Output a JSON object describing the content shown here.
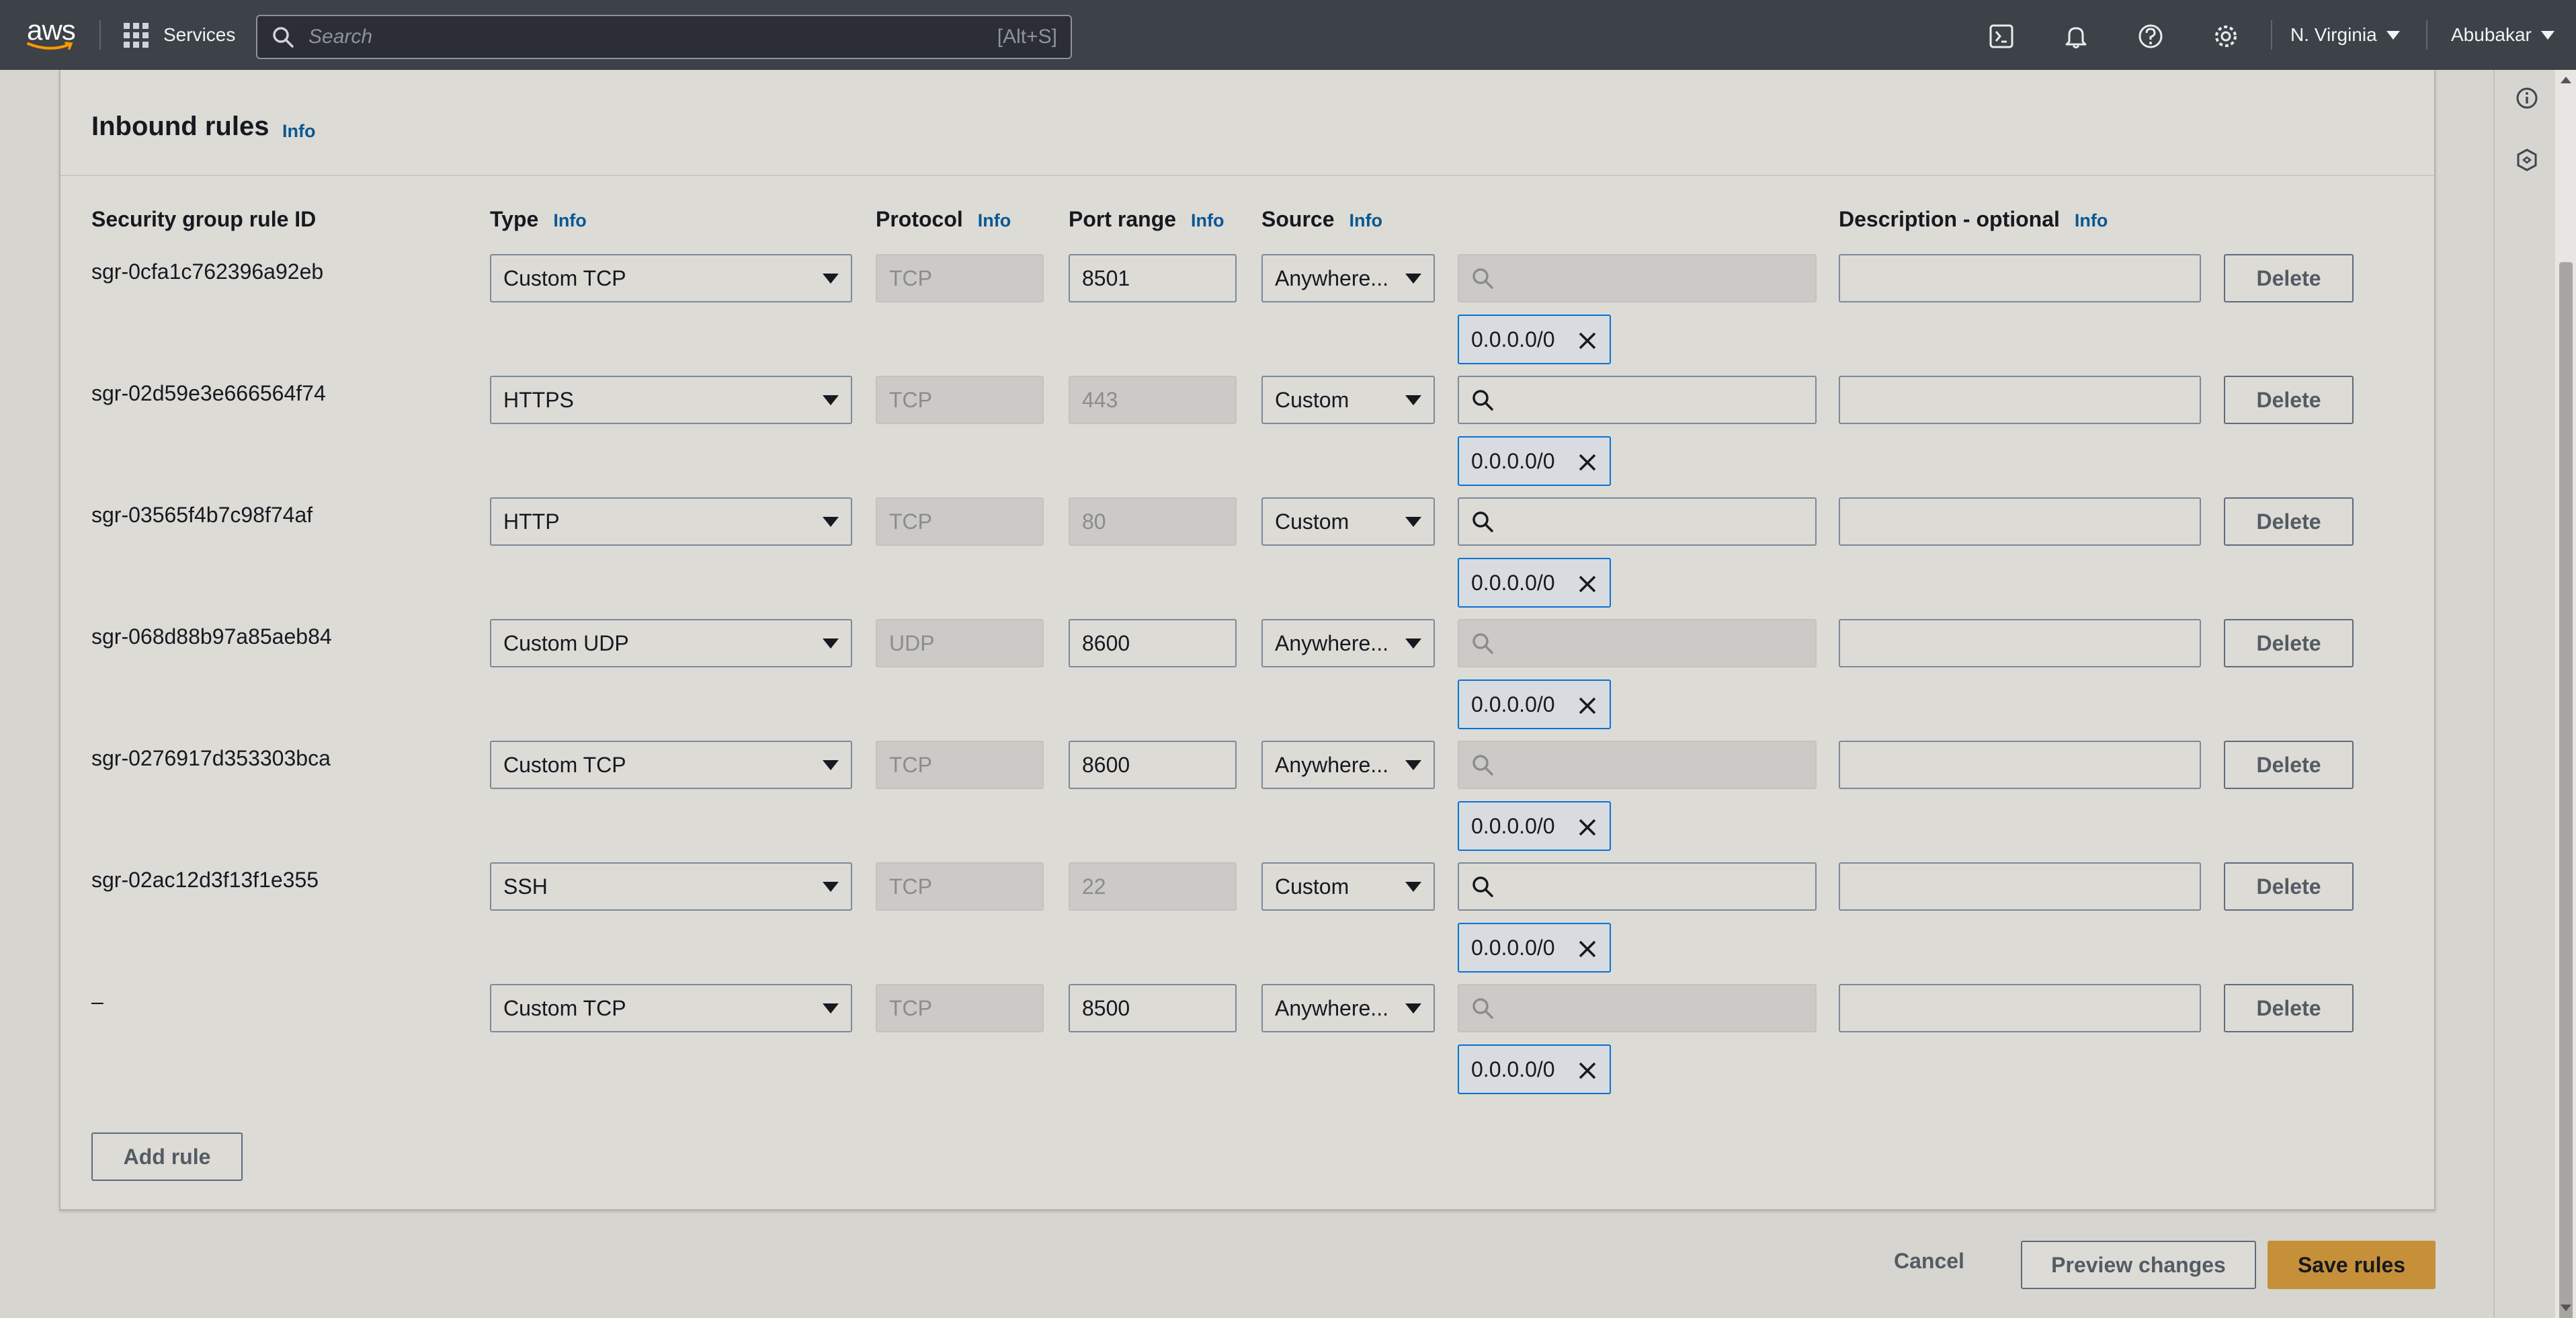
{
  "nav": {
    "logo_text": "aws",
    "services_label": "Services",
    "search_placeholder": "Search",
    "search_shortcut": "[Alt+S]",
    "region": "N. Virginia",
    "account": "Abubakar"
  },
  "panel": {
    "title": "Inbound rules",
    "info": "Info"
  },
  "columns": {
    "rule_id": "Security group rule ID",
    "type": "Type",
    "protocol": "Protocol",
    "port_range": "Port range",
    "source": "Source",
    "description": "Description - optional",
    "info": "Info"
  },
  "rules": [
    {
      "id": "sgr-0cfa1c762396a92eb",
      "type": "Custom TCP",
      "protocol": "TCP",
      "port": "8501",
      "port_editable": true,
      "source": "Anywhere...",
      "search_enabled": false,
      "cidr": "0.0.0.0/0",
      "delete": "Delete"
    },
    {
      "id": "sgr-02d59e3e666564f74",
      "type": "HTTPS",
      "protocol": "TCP",
      "port": "443",
      "port_editable": false,
      "source": "Custom",
      "search_enabled": true,
      "cidr": "0.0.0.0/0",
      "delete": "Delete"
    },
    {
      "id": "sgr-03565f4b7c98f74af",
      "type": "HTTP",
      "protocol": "TCP",
      "port": "80",
      "port_editable": false,
      "source": "Custom",
      "search_enabled": true,
      "cidr": "0.0.0.0/0",
      "delete": "Delete"
    },
    {
      "id": "sgr-068d88b97a85aeb84",
      "type": "Custom UDP",
      "protocol": "UDP",
      "port": "8600",
      "port_editable": true,
      "source": "Anywhere...",
      "search_enabled": false,
      "cidr": "0.0.0.0/0",
      "delete": "Delete"
    },
    {
      "id": "sgr-0276917d353303bca",
      "type": "Custom TCP",
      "protocol": "TCP",
      "port": "8600",
      "port_editable": true,
      "source": "Anywhere...",
      "search_enabled": false,
      "cidr": "0.0.0.0/0",
      "delete": "Delete"
    },
    {
      "id": "sgr-02ac12d3f13f1e355",
      "type": "SSH",
      "protocol": "TCP",
      "port": "22",
      "port_editable": false,
      "source": "Custom",
      "search_enabled": true,
      "cidr": "0.0.0.0/0",
      "delete": "Delete"
    },
    {
      "id": "–",
      "type": "Custom TCP",
      "protocol": "TCP",
      "port": "8500",
      "port_editable": true,
      "source": "Anywhere...",
      "search_enabled": false,
      "cidr": "0.0.0.0/0",
      "delete": "Delete"
    }
  ],
  "actions": {
    "add_rule": "Add rule",
    "cancel": "Cancel",
    "preview": "Preview changes",
    "save": "Save rules"
  },
  "colors": {
    "nav_bg": "#3d4249",
    "primary": "#c69039",
    "token_border": "#0972d3",
    "info_link": "#0a5792"
  }
}
